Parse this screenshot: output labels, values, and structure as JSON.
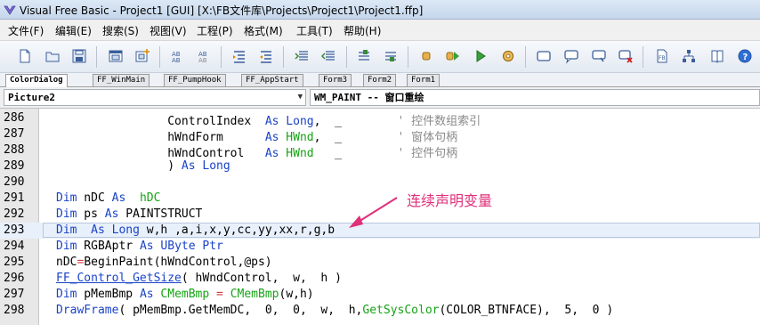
{
  "window": {
    "title": "Visual Free Basic - Project1 [GUI]  [X:\\FB文件库\\Projects\\Project1\\Project1.ffp]"
  },
  "menu": {
    "items": [
      "文件(F)",
      "编辑(E)",
      "搜索(S)",
      "视图(V)",
      "工程(P)",
      "格式(M)",
      "工具(T)",
      "帮助(H)"
    ]
  },
  "toolbar": {
    "icons": [
      "new-file-icon",
      "open-folder-icon",
      "save-icon",
      "new-form-icon",
      "add-form-icon",
      "find-icon",
      "replace-icon",
      "indent-icon",
      "outdent-icon",
      "comment-icon",
      "uncomment-icon",
      "bookmark-icon",
      "bookmark-next-icon",
      "compile-icon",
      "compile-run-icon",
      "run-icon",
      "settings-icon",
      "window-icon",
      "dialog-icon",
      "message-icon",
      "delete-icon",
      "fb-doc-icon",
      "tree-icon",
      "help-icon"
    ]
  },
  "tabs": {
    "items": [
      "ColorDialog",
      "FF_WinMain",
      "FF_PumpHook",
      "FF_AppStart",
      "Form3",
      "Form2",
      "Form1"
    ],
    "active": "ColorDialog"
  },
  "selectors": {
    "object": "Picture2",
    "event": "WM_PAINT -- 窗口重绘"
  },
  "editor": {
    "current_line": "293",
    "lines": [
      {
        "n": "286",
        "code": "                ControlIndex  As Long,  _        ' 控件数组索引"
      },
      {
        "n": "287",
        "code": "                hWndForm      As HWnd,  _        ' 窗体句柄"
      },
      {
        "n": "288",
        "code": "                hWndControl   As HWnd   _        ' 控件句柄"
      },
      {
        "n": "289",
        "code": "                ) As Long"
      },
      {
        "n": "290",
        "code": ""
      },
      {
        "n": "291",
        "code": "Dim nDC As  hDC"
      },
      {
        "n": "292",
        "code": "Dim ps As PAINTSTRUCT"
      },
      {
        "n": "293",
        "code": "Dim  As Long w,h ,a,i,x,y,cc,yy,xx,r,g,b"
      },
      {
        "n": "294",
        "code": "Dim RGBAptr As UByte Ptr"
      },
      {
        "n": "295",
        "code": "nDC=BeginPaint(hWndControl,@ps)"
      },
      {
        "n": "296",
        "code": "FF_Control_GetSize( hWndControl,  w,  h )"
      },
      {
        "n": "297",
        "code": "Dim pMemBmp As CMemBmp = CMemBmp(w,h)"
      },
      {
        "n": "298",
        "code": "DrawFrame( pMemBmp.GetMemDC,  0,  0,  w,  h,GetSysColor(COLOR_BTNFACE),  5,  0 )"
      }
    ]
  },
  "annotation": {
    "text": "连续声明变量",
    "color": "#e0307a"
  },
  "colors": {
    "keyword": "#1a43c8",
    "api": "#16a314",
    "comment": "#8a8a8a",
    "current_line": "#e8f0fb"
  }
}
